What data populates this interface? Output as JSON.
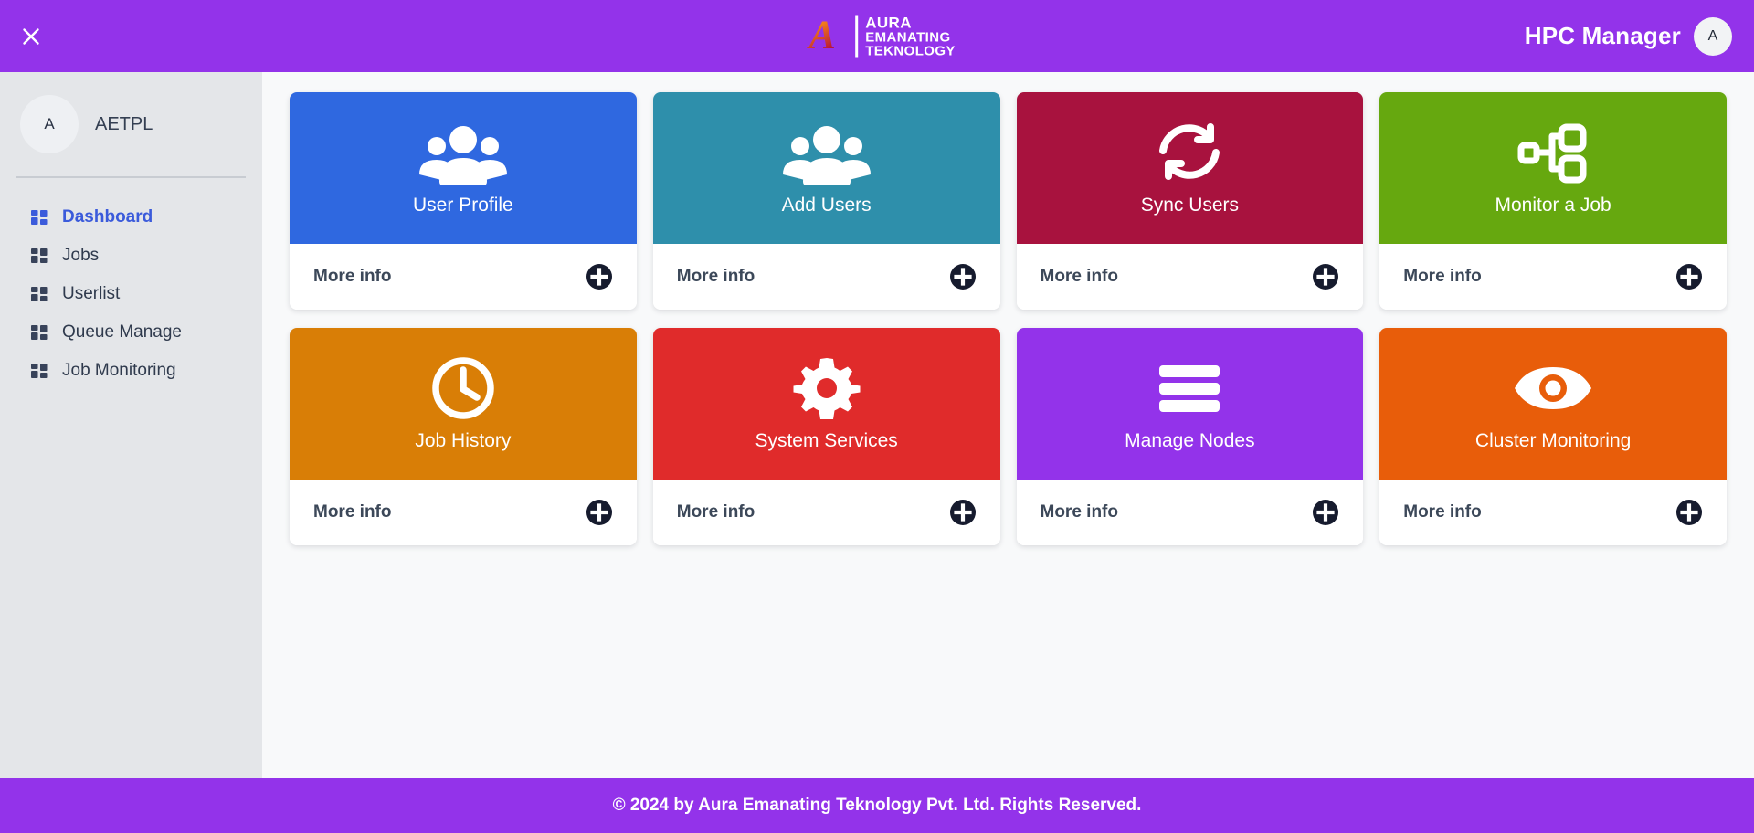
{
  "header": {
    "close_icon": "close-icon",
    "logo": {
      "monogram": "A",
      "line1": "AURA",
      "line2": "EMANATING",
      "line3": "TEKNOLOGY"
    },
    "app_title": "HPC Manager",
    "avatar_initial": "A"
  },
  "sidebar": {
    "avatar_initial": "A",
    "username": "AETPL",
    "items": [
      {
        "label": "Dashboard",
        "icon": "grid-icon",
        "active": true
      },
      {
        "label": "Jobs",
        "icon": "grid-icon",
        "active": false
      },
      {
        "label": "Userlist",
        "icon": "grid-icon",
        "active": false
      },
      {
        "label": "Queue Manage",
        "icon": "grid-icon",
        "active": false
      },
      {
        "label": "Job Monitoring",
        "icon": "grid-icon",
        "active": false
      }
    ]
  },
  "main": {
    "more_info_label": "More info",
    "more_info_icon": "circle-plus-icon",
    "cards": [
      {
        "title": "User Profile",
        "icon": "users-group-icon",
        "color": "#2f68e0",
        "more_info": "More info"
      },
      {
        "title": "Add Users",
        "icon": "users-group-icon",
        "color": "#2e8fab",
        "more_info": "More info"
      },
      {
        "title": "Sync Users",
        "icon": "sync-arrows-icon",
        "color": "#a8123e",
        "more_info": "More info"
      },
      {
        "title": "Monitor a Job",
        "icon": "project-diagram-icon",
        "color": "#66a80f",
        "more_info": "More info"
      },
      {
        "title": "Job History",
        "icon": "clock-icon",
        "color": "#d97e06",
        "more_info": "More info"
      },
      {
        "title": "System Services",
        "icon": "gear-icon",
        "color": "#e02b2b",
        "more_info": "More info"
      },
      {
        "title": "Manage Nodes",
        "icon": "bars-icon",
        "color": "#9333ea",
        "more_info": "More info"
      },
      {
        "title": "Cluster Monitoring",
        "icon": "eye-icon",
        "color": "#e85d0a",
        "more_info": "More info"
      }
    ]
  },
  "footer": {
    "text": "© 2024 by Aura Emanating Teknology Pvt. Ltd. Rights Reserved."
  },
  "colors": {
    "brand_purple": "#9333ea",
    "sidebar_bg": "#e4e6e9",
    "content_bg": "#f8f9fa",
    "active_nav": "#3b5bdb",
    "plus_dark": "#161b2e"
  }
}
